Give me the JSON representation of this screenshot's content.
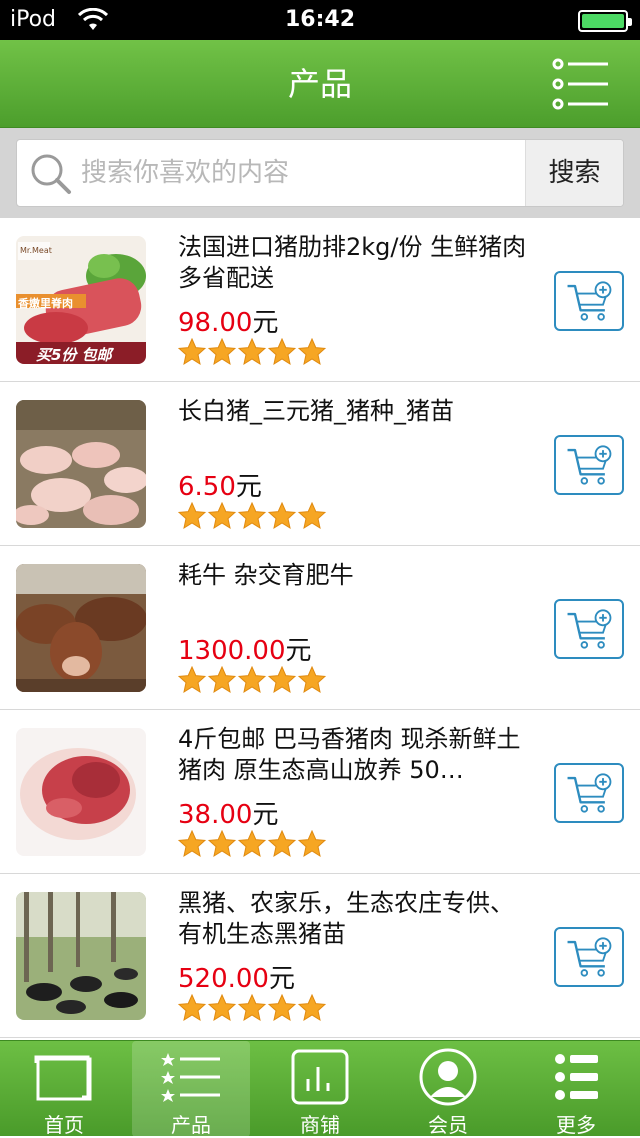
{
  "status_bar": {
    "carrier": "iPod",
    "time": "16:42"
  },
  "nav": {
    "title": "产品"
  },
  "search": {
    "placeholder": "搜索你喜欢的内容",
    "button": "搜索"
  },
  "currency_suffix": "元",
  "products": [
    {
      "title": "法国进口猪肋排2kg/份 生鲜猪肉 多省配送",
      "price": "98.00",
      "rating": 5,
      "thumb_text": "买5份 包邮",
      "thumb_badge": "香嫩里脊肉",
      "thumb_logo": "Mr.Meat"
    },
    {
      "title": "长白猪_三元猪_猪种_猪苗",
      "price": "6.50",
      "rating": 5
    },
    {
      "title": "耗牛 杂交育肥牛",
      "price": "1300.00",
      "rating": 5
    },
    {
      "title": "4斤包邮 巴马香猪肉 现杀新鲜土猪肉 原生态高山放养 50…",
      "price": "38.00",
      "rating": 5
    },
    {
      "title": "黑猪、农家乐，生态农庄专供、有机生态黑猪苗",
      "price": "520.00",
      "rating": 5
    }
  ],
  "tabs": [
    {
      "label": "首页",
      "icon": "home-icon"
    },
    {
      "label": "产品",
      "icon": "product-list-icon",
      "active": true
    },
    {
      "label": "商铺",
      "icon": "store-icon"
    },
    {
      "label": "会员",
      "icon": "member-icon"
    },
    {
      "label": "更多",
      "icon": "more-icon"
    }
  ],
  "colors": {
    "nav_green": "#5cb037",
    "price_red": "#e60012",
    "cart_blue": "#2d8cbf",
    "star": "#f6a623"
  }
}
